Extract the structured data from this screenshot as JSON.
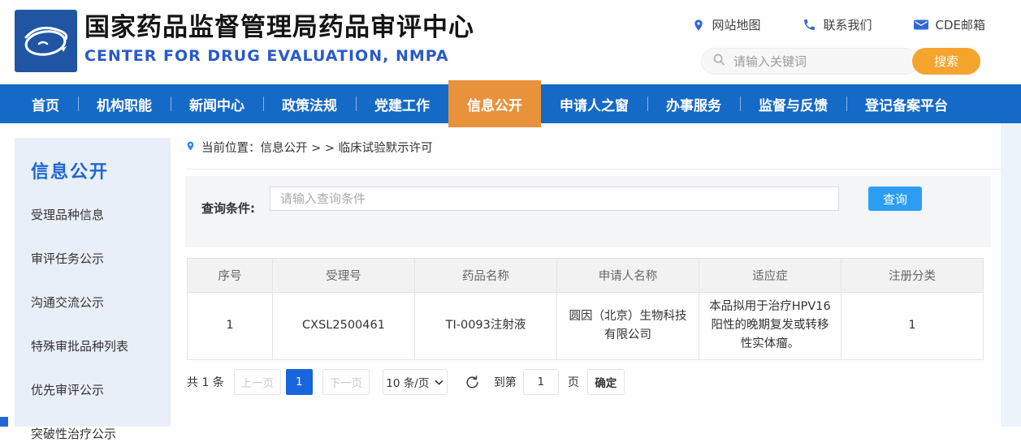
{
  "header": {
    "title": "国家药品监督管理局药品审评中心",
    "subtitle": "CENTER FOR DRUG EVALUATION, NMPA",
    "quick_links": [
      {
        "icon": "location-pin-icon",
        "label": "网站地图"
      },
      {
        "icon": "phone-icon",
        "label": "联系我们"
      },
      {
        "icon": "mail-icon",
        "label": "CDE邮箱"
      }
    ],
    "search": {
      "placeholder": "请输入关键词",
      "button_label": "搜索"
    }
  },
  "nav": {
    "items": [
      {
        "label": "首页",
        "active": false
      },
      {
        "label": "机构职能",
        "active": false
      },
      {
        "label": "新闻中心",
        "active": false
      },
      {
        "label": "政策法规",
        "active": false
      },
      {
        "label": "党建工作",
        "active": false
      },
      {
        "label": "信息公开",
        "active": true
      },
      {
        "label": "申请人之窗",
        "active": false
      },
      {
        "label": "办事服务",
        "active": false
      },
      {
        "label": "监督与反馈",
        "active": false
      },
      {
        "label": "登记备案平台",
        "active": false
      }
    ]
  },
  "sidebar": {
    "title": "信息公开",
    "items": [
      "受理品种信息",
      "审评任务公示",
      "沟通交流公示",
      "特殊审批品种列表",
      "优先审评公示",
      "突破性治疗公示"
    ]
  },
  "breadcrumb": {
    "text": "当前位置：信息公开 > > 临床试验默示许可"
  },
  "query": {
    "label": "查询条件:",
    "placeholder": "请输入查询条件",
    "button_label": "查询"
  },
  "table": {
    "headers": [
      "序号",
      "受理号",
      "药品名称",
      "申请人名称",
      "适应症",
      "注册分类"
    ],
    "rows": [
      {
        "index": "1",
        "acceptance_no": "CXSL2500461",
        "drug_name": "TI-0093注射液",
        "applicant": "圆因（北京）生物科技有限公司",
        "indication": "本品拟用于治疗HPV16阳性的晚期复发或转移性实体瘤。",
        "registration_class": "1"
      }
    ]
  },
  "pagination": {
    "total_text": "共 1 条",
    "prev_label": "上一页",
    "current_page": "1",
    "next_label": "下一页",
    "page_size_label": "10 条/页",
    "goto_label": "到第",
    "goto_value": "1",
    "goto_unit": "页",
    "confirm_label": "确定"
  },
  "colors": {
    "nav_blue": "#1569c7",
    "active_orange": "#e8923c",
    "search_orange": "#f5a42e",
    "subtitle_blue": "#2a5ac9",
    "query_button_blue": "#2b9ef3",
    "page_active_blue": "#1766dd",
    "sidebar_bg": "#e9eff8"
  }
}
